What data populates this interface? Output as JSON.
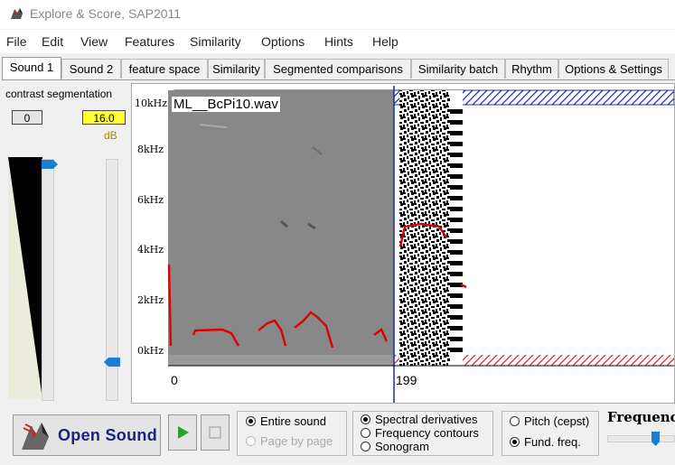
{
  "window": {
    "title": "Explore & Score, SAP2011"
  },
  "menu": [
    "File",
    "Edit",
    "View",
    "Features",
    "Similarity",
    "Options",
    "Hints",
    "Help"
  ],
  "tabs": [
    "Sound 1",
    "Sound 2",
    "feature space",
    "Similarity",
    "Segmented comparisons",
    "Similarity batch",
    "Rhythm",
    "Options & Settings"
  ],
  "left_panel": {
    "header": "contrast segmentation",
    "contrast_value": "0",
    "segmentation_value": "16.0",
    "unit": "dB",
    "contrast_level": 0.04,
    "segmentation_level": 0.85
  },
  "spectrogram": {
    "filename": "ML__BcPi10.wav",
    "freq_labels": [
      "10kHz",
      "8kHz",
      "6kHz",
      "4kHz",
      "2kHz",
      "0kHz"
    ],
    "x_labels": [
      "0",
      "199"
    ]
  },
  "controls": {
    "open_sound_label": "Open Sound",
    "view_mode": [
      "Entire sound",
      "Page by page"
    ],
    "view_selected": "Entire sound",
    "display_mode": [
      "Spectral derivatives",
      "Frequency contours",
      "Sonogram"
    ],
    "display_selected": "Spectral derivatives",
    "pitch_mode": [
      "Pitch (cepst)",
      "Fund. freq."
    ],
    "pitch_selected": "Fund. freq.",
    "frequency_label": "Frequency"
  },
  "colors": {
    "highlight_yellow": "#ffff33",
    "thumb_blue": "#1a7fd4",
    "contour_red": "#e00000",
    "cursor_blue": "#1c2fa8"
  }
}
